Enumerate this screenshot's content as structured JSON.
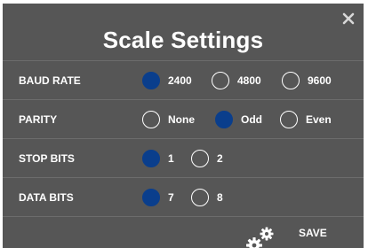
{
  "dialog": {
    "title": "Scale Settings",
    "close_icon": "close-icon",
    "save_label": "SAVE",
    "save_icon": "gears-icon",
    "selected_color": "#0a3e8c",
    "background_color": "#565656"
  },
  "settings": {
    "baud_rate": {
      "label": "BAUD RATE",
      "options": [
        "2400",
        "4800",
        "9600"
      ],
      "selected": "2400"
    },
    "parity": {
      "label": "PARITY",
      "options": [
        "None",
        "Odd",
        "Even"
      ],
      "selected": "Odd"
    },
    "stop_bits": {
      "label": "STOP BITS",
      "options": [
        "1",
        "2"
      ],
      "selected": "1"
    },
    "data_bits": {
      "label": "DATA BITS",
      "options": [
        "7",
        "8"
      ],
      "selected": "7"
    }
  }
}
